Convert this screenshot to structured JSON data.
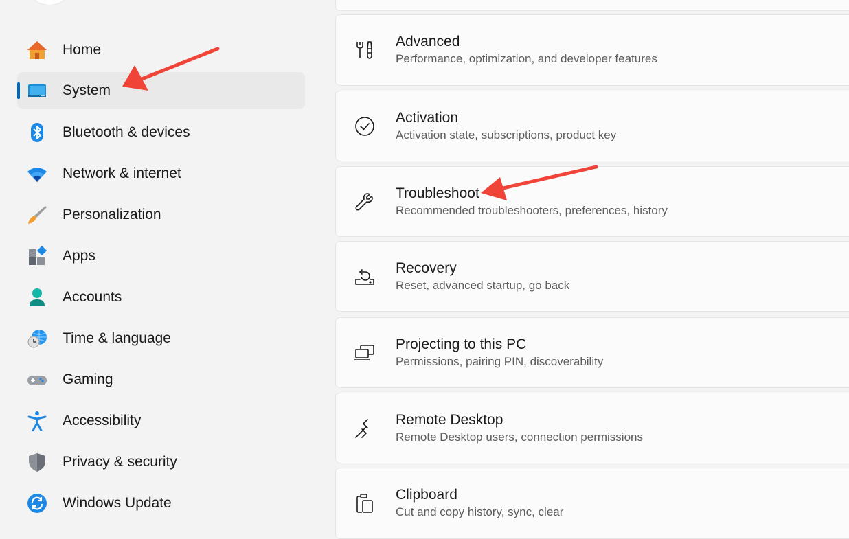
{
  "sidebar": {
    "items": [
      {
        "label": "Home",
        "icon": "home-icon",
        "selected": false
      },
      {
        "label": "System",
        "icon": "system-icon",
        "selected": true
      },
      {
        "label": "Bluetooth & devices",
        "icon": "bluetooth-icon",
        "selected": false
      },
      {
        "label": "Network & internet",
        "icon": "wifi-icon",
        "selected": false
      },
      {
        "label": "Personalization",
        "icon": "paintbrush-icon",
        "selected": false
      },
      {
        "label": "Apps",
        "icon": "apps-icon",
        "selected": false
      },
      {
        "label": "Accounts",
        "icon": "accounts-icon",
        "selected": false
      },
      {
        "label": "Time & language",
        "icon": "globe-clock-icon",
        "selected": false
      },
      {
        "label": "Gaming",
        "icon": "gamepad-icon",
        "selected": false
      },
      {
        "label": "Accessibility",
        "icon": "accessibility-icon",
        "selected": false
      },
      {
        "label": "Privacy & security",
        "icon": "shield-icon",
        "selected": false
      },
      {
        "label": "Windows Update",
        "icon": "update-icon",
        "selected": false
      }
    ]
  },
  "main": {
    "cards": [
      {
        "title": "Advanced",
        "subtitle": "Performance, optimization, and developer features",
        "icon": "tools-icon"
      },
      {
        "title": "Activation",
        "subtitle": "Activation state, subscriptions, product key",
        "icon": "check-circle-icon"
      },
      {
        "title": "Troubleshoot",
        "subtitle": "Recommended troubleshooters, preferences, history",
        "icon": "wrench-icon"
      },
      {
        "title": "Recovery",
        "subtitle": "Reset, advanced startup, go back",
        "icon": "recovery-icon"
      },
      {
        "title": "Projecting to this PC",
        "subtitle": "Permissions, pairing PIN, discoverability",
        "icon": "projecting-icon"
      },
      {
        "title": "Remote Desktop",
        "subtitle": "Remote Desktop users, connection permissions",
        "icon": "remote-desktop-icon"
      },
      {
        "title": "Clipboard",
        "subtitle": "Cut and copy history, sync, clear",
        "icon": "clipboard-icon"
      }
    ]
  },
  "colors": {
    "accent": "#0067c0",
    "annotation_arrow": "#f04438",
    "card_background": "#fbfbfb",
    "page_background": "#f3f3f3"
  }
}
